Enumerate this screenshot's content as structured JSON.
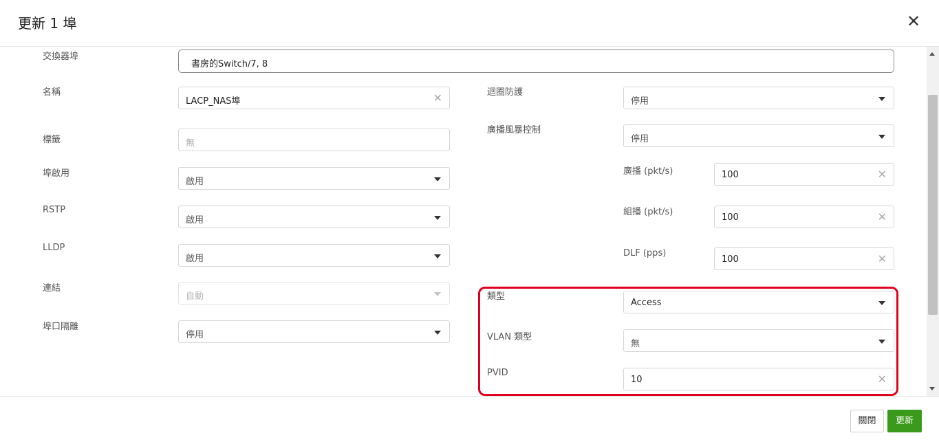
{
  "dialog": {
    "title": "更新 1 埠"
  },
  "left": {
    "port": {
      "label": "交換器埠",
      "value": "書房的Switch/7, 8"
    },
    "name": {
      "label": "名稱",
      "value": "LACP_NAS埠"
    },
    "tag": {
      "label": "標籤",
      "placeholder": "無"
    },
    "port_enable": {
      "label": "埠啟用",
      "value": "啟用"
    },
    "rstp": {
      "label": "RSTP",
      "value": "啟用"
    },
    "lldp": {
      "label": "LLDP",
      "value": "啟用"
    },
    "link": {
      "label": "連結",
      "value": "自動"
    },
    "isolation": {
      "label": "埠口隔離",
      "value": "停用"
    }
  },
  "right": {
    "loop_guard": {
      "label": "迴圈防護",
      "value": "停用"
    },
    "storm_control": {
      "label": "廣播風暴控制",
      "value": "停用"
    },
    "broadcast": {
      "label": "廣播 (pkt/s)",
      "value": "100"
    },
    "multicast": {
      "label": "組播 (pkt/s)",
      "value": "100"
    },
    "dlf": {
      "label": "DLF (pps)",
      "value": "100"
    },
    "type": {
      "label": "類型",
      "value": "Access"
    },
    "vlan_type": {
      "label": "VLAN 類型",
      "value": "無"
    },
    "pvid": {
      "label": "PVID",
      "value": "10"
    }
  },
  "footer": {
    "close_label": "關閉",
    "update_label": "更新"
  },
  "colors": {
    "highlight": "#e0001b",
    "primary": "#3a9a1c"
  },
  "icons": {
    "close": "close-icon",
    "dropdown": "chevron-down-icon",
    "clear": "clear-icon"
  }
}
